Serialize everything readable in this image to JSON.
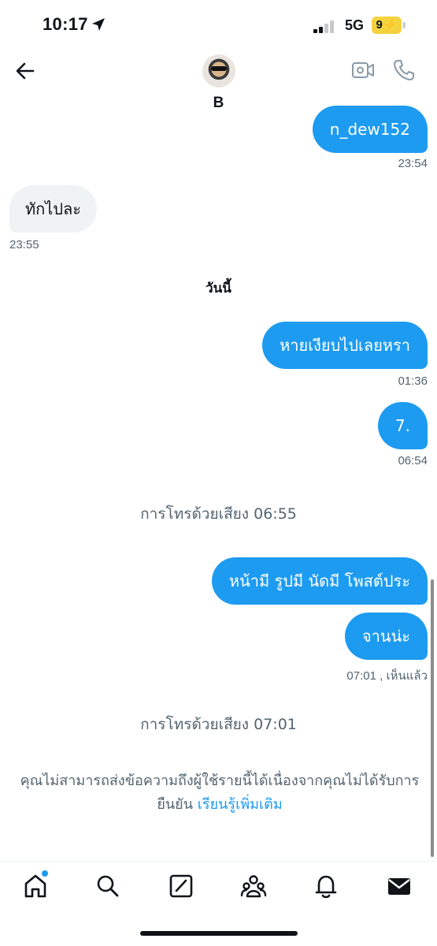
{
  "status_bar": {
    "time": "10:17",
    "network": "5G",
    "battery": "9"
  },
  "header": {
    "contact_name": "B"
  },
  "messages": [
    {
      "text": "n_dew152",
      "time": "23:54"
    },
    {
      "text": "ทักไปละ",
      "time": "23:55"
    },
    {
      "text": "หายเงียบไปเลยหรา",
      "time": "01:36"
    },
    {
      "text": "7.",
      "time": "06:54"
    },
    {
      "text": "หน้ามี รูปมี นัดมี โพสต์ประ"
    },
    {
      "text": "จานน่ะ",
      "time": "07:01 , เห็นแล้ว"
    }
  ],
  "date_separator": "วันนี้",
  "call_events": [
    "การโทรด้วยเสียง 06:55",
    "การโทรด้วยเสียง 07:01"
  ],
  "notice": {
    "text": "คุณไม่สามารถส่งข้อความถึงผู้ใช้รายนี้ได้เนื่องจากคุณไม่ได้รับการยืนยัน",
    "link": "เรียนรู้เพิ่มเติม"
  },
  "bottom_nav": [
    "home-icon",
    "search-icon",
    "compose-icon",
    "communities-icon",
    "notifications-icon",
    "messages-icon"
  ],
  "colors": {
    "accent": "#1d9bf0",
    "incoming_bubble": "#eff3f4",
    "secondary_text": "#536471",
    "battery": "#f5d33f"
  }
}
